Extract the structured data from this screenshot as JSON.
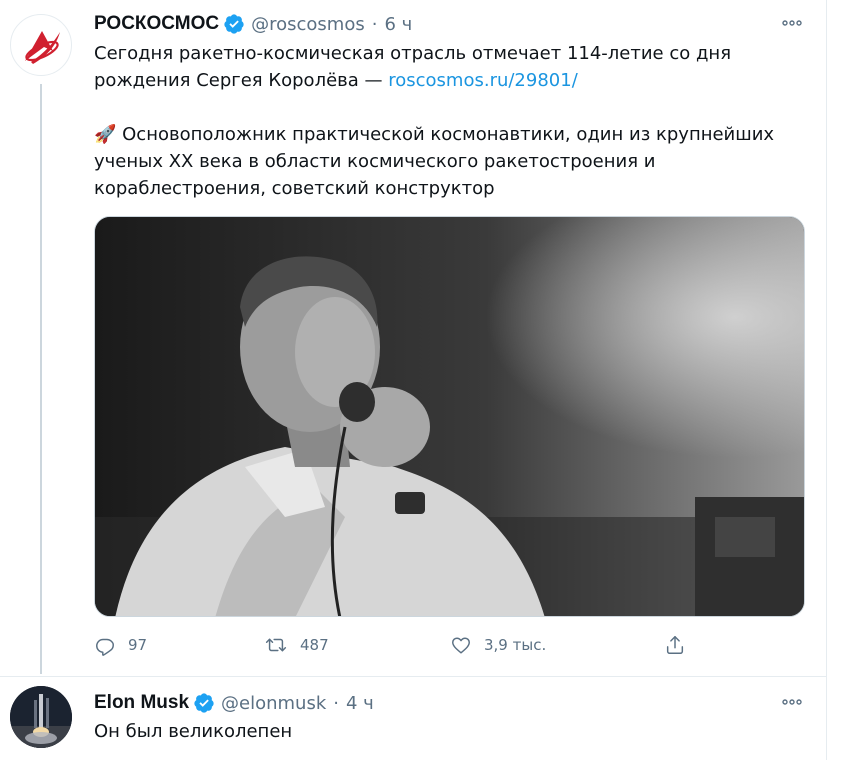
{
  "tweets": [
    {
      "author": {
        "name": "РОСКОСМОС",
        "handle": "@roscosmos"
      },
      "separator": "·",
      "time": "6 ч",
      "text": {
        "line1": "Сегодня ракетно-космическая отрасль отмечает 114-летие со дня",
        "line2_prefix": "рождения Сергея Королёва — ",
        "link": "roscosmos.ru/29801/",
        "emoji": "🚀",
        "p2_line1": " Основоположник практической космонавтики, один из крупнейших",
        "p2_line2": "ученых XX века в области космического ракетостроения и",
        "p2_line3": "кораблестроения, советский конструктор"
      },
      "actions": {
        "replies": "97",
        "retweets": "487",
        "likes": "3,9 тыс."
      },
      "icons": {
        "avatar": "roscosmos-logo",
        "verified": "verified-badge-icon",
        "more": "more-icon",
        "reply": "reply-icon",
        "retweet": "retweet-icon",
        "like": "heart-icon",
        "share": "share-icon"
      }
    },
    {
      "author": {
        "name": "Elon Musk",
        "handle": "@elonmusk"
      },
      "separator": "·",
      "time": "4 ч",
      "text": "Он был великолепен",
      "icons": {
        "avatar": "rocket-launch-photo",
        "verified": "verified-badge-icon",
        "more": "more-icon"
      }
    }
  ],
  "colors": {
    "link": "#1b95e0",
    "verified": "#1da1f2",
    "secondary_text": "#5b7083",
    "roscosmos_red": "#d0202f",
    "divider": "#e6ecf0"
  }
}
